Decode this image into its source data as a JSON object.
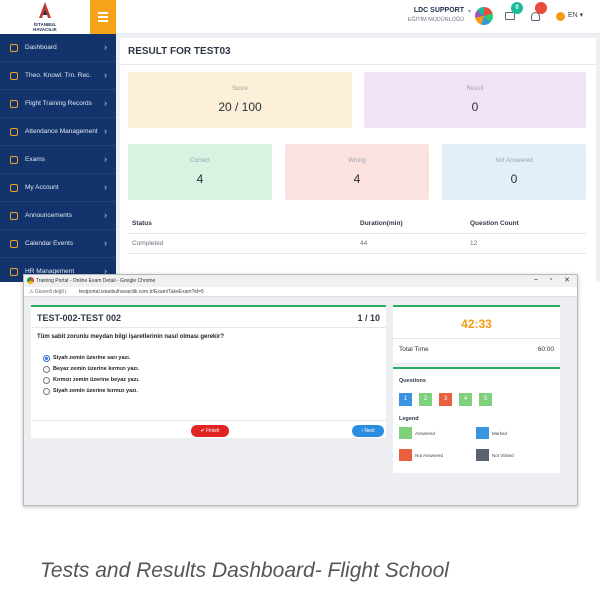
{
  "brand": {
    "logo_text": "İSTANBUL HAVACILIK"
  },
  "header": {
    "user_name": "LDC SUPPORT",
    "user_role": "EĞİTİM MÜDÜRLÜĞÜ",
    "mail_count": "0",
    "notification_count": "",
    "language": "EN"
  },
  "sidebar": {
    "items": [
      {
        "label": "Dashboard",
        "icon": "dashboard-icon"
      },
      {
        "label": "Theo. Knowl. Trn. Rec.",
        "icon": "calendar-icon"
      },
      {
        "label": "Flight Training Records",
        "icon": "plane-icon"
      },
      {
        "label": "Attendance Management",
        "icon": "list-icon"
      },
      {
        "label": "Exams",
        "icon": "exam-icon"
      },
      {
        "label": "My Account",
        "icon": "key-icon"
      },
      {
        "label": "Announcements",
        "icon": "megaphone-icon"
      },
      {
        "label": "Calendar Events",
        "icon": "grid-icon"
      },
      {
        "label": "HR Management",
        "icon": "users-icon"
      }
    ]
  },
  "result": {
    "title": "RESULT FOR TEST03",
    "cards": [
      {
        "label": "Score",
        "value": "20 / 100",
        "color": "#fdf0d8"
      },
      {
        "label": "Result",
        "value": "0",
        "color": "#f1e3f6"
      },
      {
        "label": "Correct",
        "value": "4",
        "color": "#d8f3e1"
      },
      {
        "label": "Wrong",
        "value": "4",
        "color": "#fce1e1"
      },
      {
        "label": "Not Answered",
        "value": "0",
        "color": "#e1effb"
      }
    ],
    "table": {
      "headers": [
        "Status",
        "Duration(min)",
        "Question Count"
      ],
      "rows": [
        [
          "Completed",
          "44",
          "12"
        ]
      ]
    }
  },
  "browser": {
    "window_title": "Training Portal - Online Exam Detail - Google Chrome",
    "url_warning": "Güvenli değil",
    "url": "testportal.istanbulhavacilik.com.tr/Exam/TakeExam?id=5"
  },
  "exam": {
    "test_title": "TEST-002-TEST 002",
    "question_counter": "1 / 10",
    "question_text": "Tüm sabit zorunlu meydan bilgi işaretlerinin nasıl olması gerekir?",
    "options": [
      {
        "label": "Siyah zemin üzerine sarı yazı.",
        "selected": true
      },
      {
        "label": "Beyaz zemin üzerine kırmızı yazı.",
        "selected": false
      },
      {
        "label": "Kırmızı zemin üzerine beyaz yazı.",
        "selected": false
      },
      {
        "label": "Siyah zemin üzerine kırmızı yazı.",
        "selected": false
      }
    ],
    "finish_label": "✔ Finish",
    "next_label": "› Next",
    "timer": "42:33",
    "total_time_label": "Total Time",
    "total_time_value": "60:00",
    "questions_title": "Questions",
    "questions": [
      {
        "number": "1",
        "status": "marked",
        "color": "#3b93e3"
      },
      {
        "number": "2",
        "status": "answered",
        "color": "#7fd07a"
      },
      {
        "number": "3",
        "status": "not-answered",
        "color": "#e8603c"
      },
      {
        "number": "4",
        "status": "answered",
        "color": "#7fd07a"
      },
      {
        "number": "5",
        "status": "answered",
        "color": "#7fd07a"
      }
    ],
    "legend_title": "Legend",
    "legend": [
      {
        "label": "Answered",
        "color": "#7fd07a"
      },
      {
        "label": "Marked",
        "color": "#3b93e3"
      },
      {
        "label": "Not Answered",
        "color": "#e8603c"
      },
      {
        "label": "Not Visited",
        "color": "#5a6270"
      }
    ]
  },
  "caption": "Tests and Results Dashboard- Flight School"
}
